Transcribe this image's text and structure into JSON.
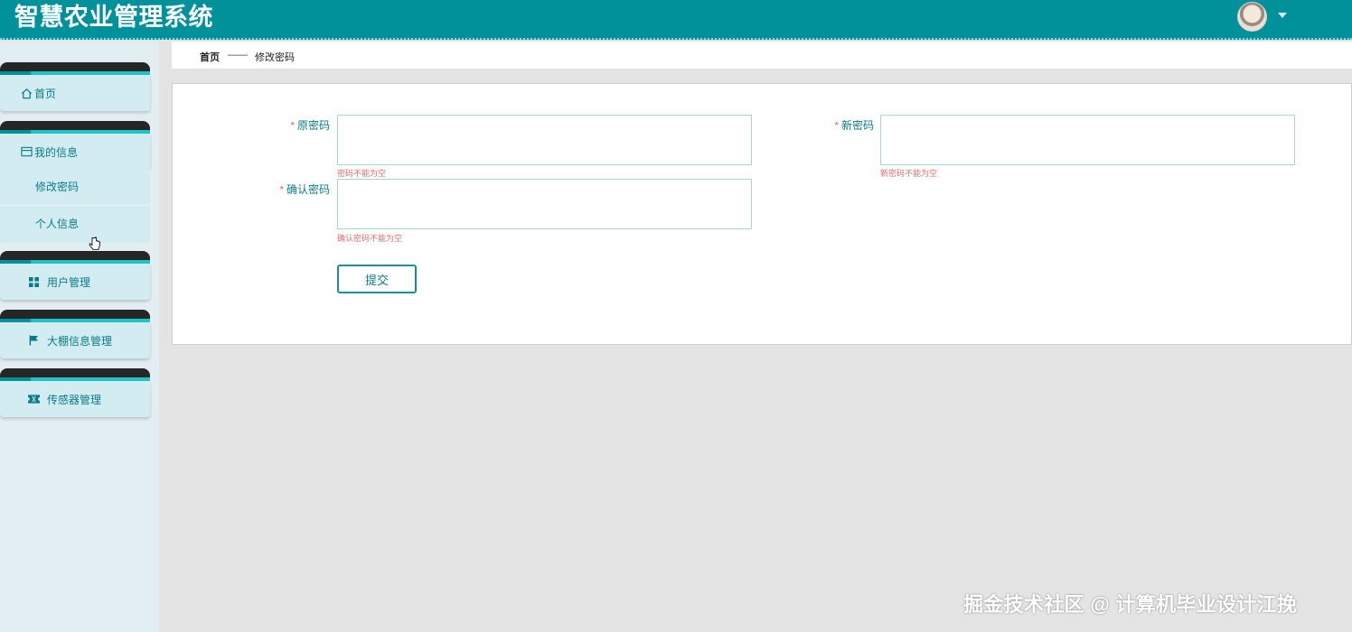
{
  "header": {
    "app_title": "智慧农业管理系统",
    "avatar_icon": "user-avatar",
    "caret_icon": "caret-down-icon"
  },
  "sidebar": {
    "menus": [
      {
        "label": "首页",
        "icon": "home-icon"
      },
      {
        "label": "我的信息",
        "icon": "id-card-icon"
      },
      {
        "label": "用户管理",
        "icon": "grid-icon"
      },
      {
        "label": "大棚信息管理",
        "icon": "flag-icon"
      },
      {
        "label": "传感器管理",
        "icon": "ticket-icon"
      }
    ],
    "submenu": [
      {
        "label": "修改密码"
      },
      {
        "label": "个人信息"
      }
    ]
  },
  "breadcrumb": {
    "home": "首页",
    "separator": "——",
    "current": "修改密码"
  },
  "form": {
    "required_mark": "*",
    "old_password": {
      "label": "原密码",
      "value": "",
      "error": "密码不能为空"
    },
    "new_password": {
      "label": "新密码",
      "value": "",
      "error": "新密码不能为空"
    },
    "confirm_password": {
      "label": "确认密码",
      "value": "",
      "error": "确认密码不能为空"
    },
    "submit_label": "提交"
  },
  "watermark": {
    "text": "掘金技术社区 @ 计算机毕业设计江挽"
  },
  "colors": {
    "header": "#00919a",
    "accent_text": "#0a7c87",
    "error": "#e06c6c",
    "menu_body": "#d2ecf1"
  }
}
